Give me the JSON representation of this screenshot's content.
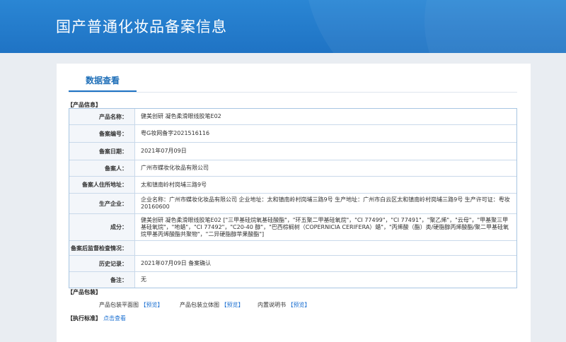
{
  "header": {
    "title": "国产普通化妆品备案信息"
  },
  "tab": {
    "label": "数据查看"
  },
  "product_section": {
    "label": "【产品信息】"
  },
  "rows": [
    {
      "label": "产品名称：",
      "value": "健美创研 凝色柔滑眼线胶笔E02"
    },
    {
      "label": "备案编号：",
      "value": "粤G妆网备字2021516116"
    },
    {
      "label": "备案日期：",
      "value": "2021年07月09日"
    },
    {
      "label": "备案人：",
      "value": "广州市蝶妆化妆品有限公司"
    },
    {
      "label": "备案人住所地址：",
      "value": "太和镇南岭村岗埔三路9号"
    },
    {
      "label": "生产企业：",
      "value": "企业名称：广州市蝶妆化妆品有限公司 企业地址：太和镇南岭村岗埔三路9号 生产地址：广州市白云区太和镇南岭村岗埔三路9号 生产许可证：粤妆20160600"
    },
    {
      "label": "成分：",
      "value": "健美创研 凝色柔滑眼线胶笔E02 [\"三甲基硅烷氧基硅酸酯\"，\"环五聚二甲基硅氧烷\"，\"CI 77499\"，\"CI 77491\"，\"聚乙烯\"，\"云母\"，\"甲基聚三甲基硅氧烷\"，\"地蜡\"，\"CI 77492\"，\"C20-40 醇\"，\"巴西棕榈树（COPERNICIA CERIFERA）蜡\"，\"丙烯酸（酯）类/硬脂醇丙烯酸酯/聚二甲基硅氧烷甲基丙烯酸酯共聚物\"，\"二异硬脂醇苹果酸酯\"]"
    },
    {
      "label": "备案后监督检查情况：",
      "value": ""
    },
    {
      "label": "历史记录：",
      "value": "2021年07月09日 备案确认"
    },
    {
      "label": "备注：",
      "value": "无"
    }
  ],
  "packaging": {
    "label": "【产品包装】",
    "items": [
      {
        "text": "产品包装平面图",
        "link": "【预览】"
      },
      {
        "text": "产品包装立体图",
        "link": "【预览】"
      },
      {
        "text": "内置说明书",
        "link": "【预览】"
      }
    ]
  },
  "standard": {
    "label": "【执行标准】",
    "link": "点击查看"
  }
}
